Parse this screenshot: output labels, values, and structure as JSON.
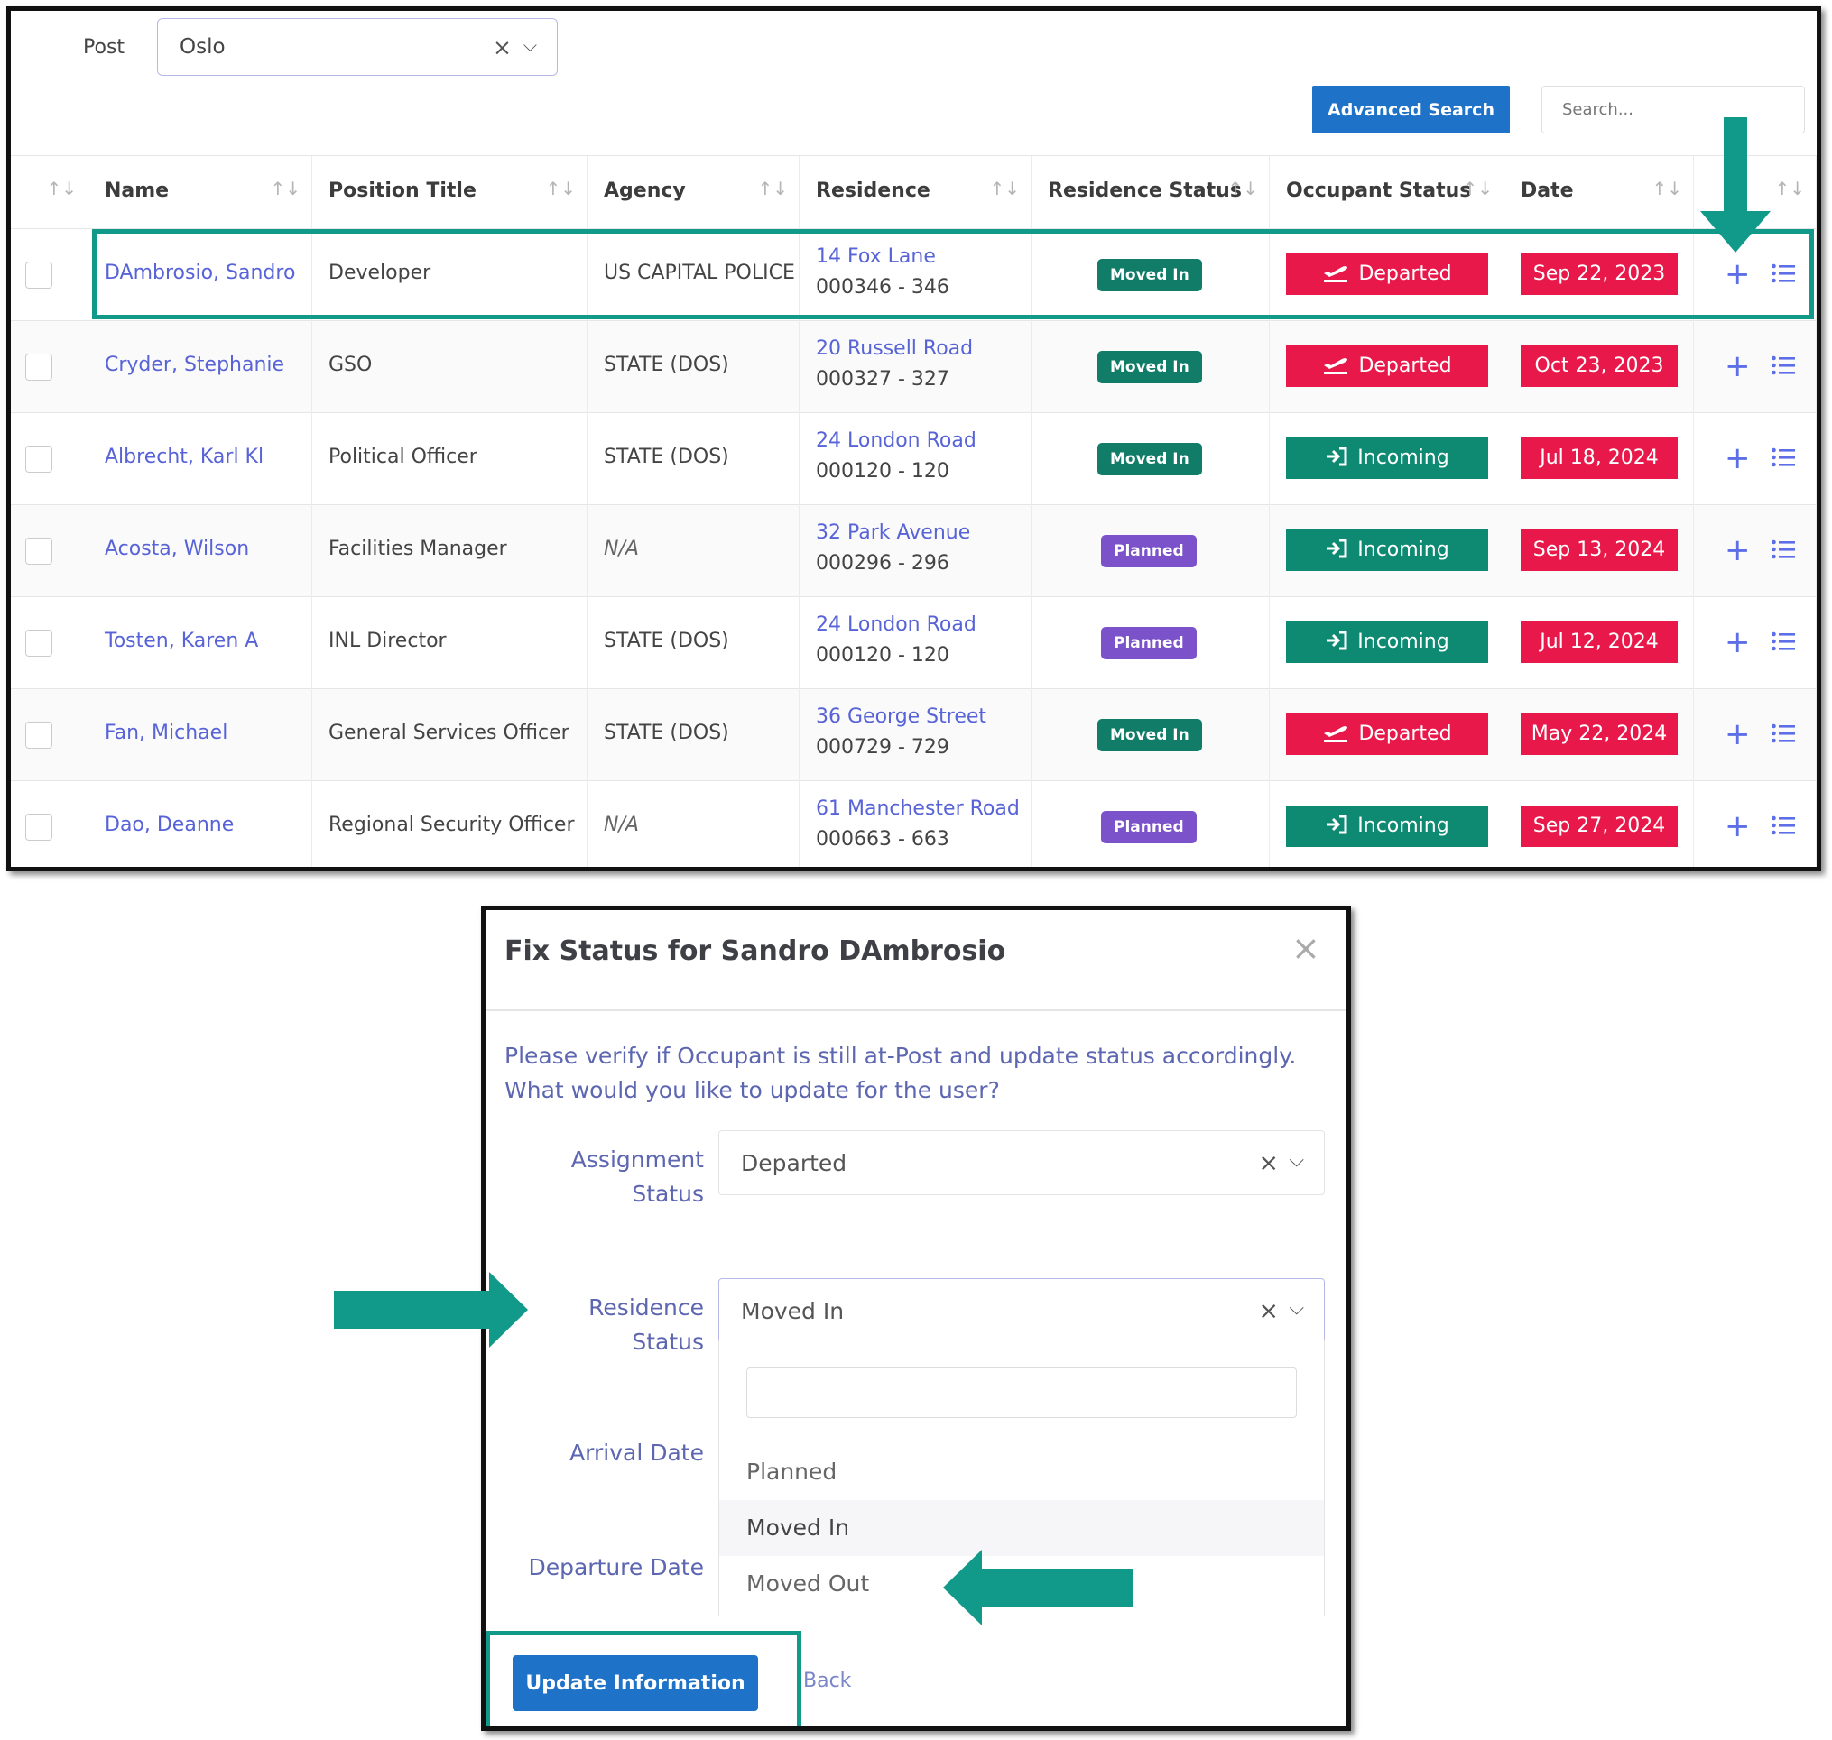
{
  "filter": {
    "post_label": "Post",
    "post_value": "Oslo",
    "clear_glyph": "×",
    "chevron_glyph": "⌵"
  },
  "toolbar": {
    "advanced_search_label": "Advanced Search",
    "search_placeholder": "Search..."
  },
  "table": {
    "columns": [
      {
        "label": ""
      },
      {
        "label": "Name"
      },
      {
        "label": "Position Title"
      },
      {
        "label": "Agency"
      },
      {
        "label": "Residence"
      },
      {
        "label": "Residence Status"
      },
      {
        "label": "Occupant Status"
      },
      {
        "label": "Date"
      },
      {
        "label": ""
      }
    ],
    "sort_glyph": "↑↓",
    "plus_glyph": "+",
    "rows": [
      {
        "name": "DAmbrosio, Sandro",
        "position": "Developer",
        "agency": "US CAPITAL POLICE",
        "residence": "14 Fox Lane",
        "residence_code": "000346 - 346",
        "residence_status": "Moved In",
        "occupant_status": "Departed",
        "date": "Sep 22, 2023"
      },
      {
        "name": "Cryder, Stephanie",
        "position": "GSO",
        "agency": "STATE (DOS)",
        "residence": "20 Russell Road",
        "residence_code": "000327 - 327",
        "residence_status": "Moved In",
        "occupant_status": "Departed",
        "date": "Oct 23, 2023"
      },
      {
        "name": "Albrecht, Karl Kl",
        "position": "Political Officer",
        "agency": "STATE (DOS)",
        "residence": "24 London Road",
        "residence_code": "000120 - 120",
        "residence_status": "Moved In",
        "occupant_status": "Incoming",
        "date": "Jul 18, 2024"
      },
      {
        "name": "Acosta, Wilson",
        "position": "Facilities Manager",
        "agency": "N/A",
        "residence": "32 Park Avenue",
        "residence_code": "000296 - 296",
        "residence_status": "Planned",
        "occupant_status": "Incoming",
        "date": "Sep 13, 2024"
      },
      {
        "name": "Tosten, Karen A",
        "position": "INL Director",
        "agency": "STATE (DOS)",
        "residence": "24 London Road",
        "residence_code": "000120 - 120",
        "residence_status": "Planned",
        "occupant_status": "Incoming",
        "date": "Jul 12, 2024"
      },
      {
        "name": "Fan, Michael",
        "position": "General Services Officer",
        "agency": "STATE (DOS)",
        "residence": "36 George Street",
        "residence_code": "000729 - 729",
        "residence_status": "Moved In",
        "occupant_status": "Departed",
        "date": "May 22, 2024"
      },
      {
        "name": "Dao, Deanne",
        "position": "Regional Security Officer",
        "agency": "N/A",
        "residence": "61 Manchester Road",
        "residence_code": "000663 - 663",
        "residence_status": "Planned",
        "occupant_status": "Incoming",
        "date": "Sep 27, 2024"
      }
    ]
  },
  "modal": {
    "title": "Fix Status for Sandro DAmbrosio",
    "close_glyph": "×",
    "message_line1": "Please verify if Occupant is still at-Post and update status accordingly.",
    "message_line2": "What would you like to update for the user?",
    "assignment_status_label_1": "Assignment",
    "assignment_status_label_2": "Status",
    "assignment_status_value": "Departed",
    "residence_status_label_1": "Residence",
    "residence_status_label_2": "Status",
    "residence_status_value": "Moved In",
    "arrival_date_label": "Arrival Date",
    "departure_date_label": "Departure Date",
    "dropdown_options": [
      "Planned",
      "Moved In",
      "Moved Out"
    ],
    "update_button_label": "Update Information",
    "back_label": "Back"
  },
  "colors": {
    "accent_teal": "#11998a",
    "primary_blue": "#1e72c7",
    "departed_red": "#e8194a",
    "incoming_green": "#0e8a73",
    "moved_in_green": "#117d68",
    "planned_purple": "#7b52c9",
    "link_blue": "#5763d6"
  },
  "icons": {
    "departed": "plane-departure-icon",
    "incoming": "sign-in-icon",
    "add": "plus-icon",
    "details": "list-icon",
    "callout": "teal-arrow-icon"
  }
}
